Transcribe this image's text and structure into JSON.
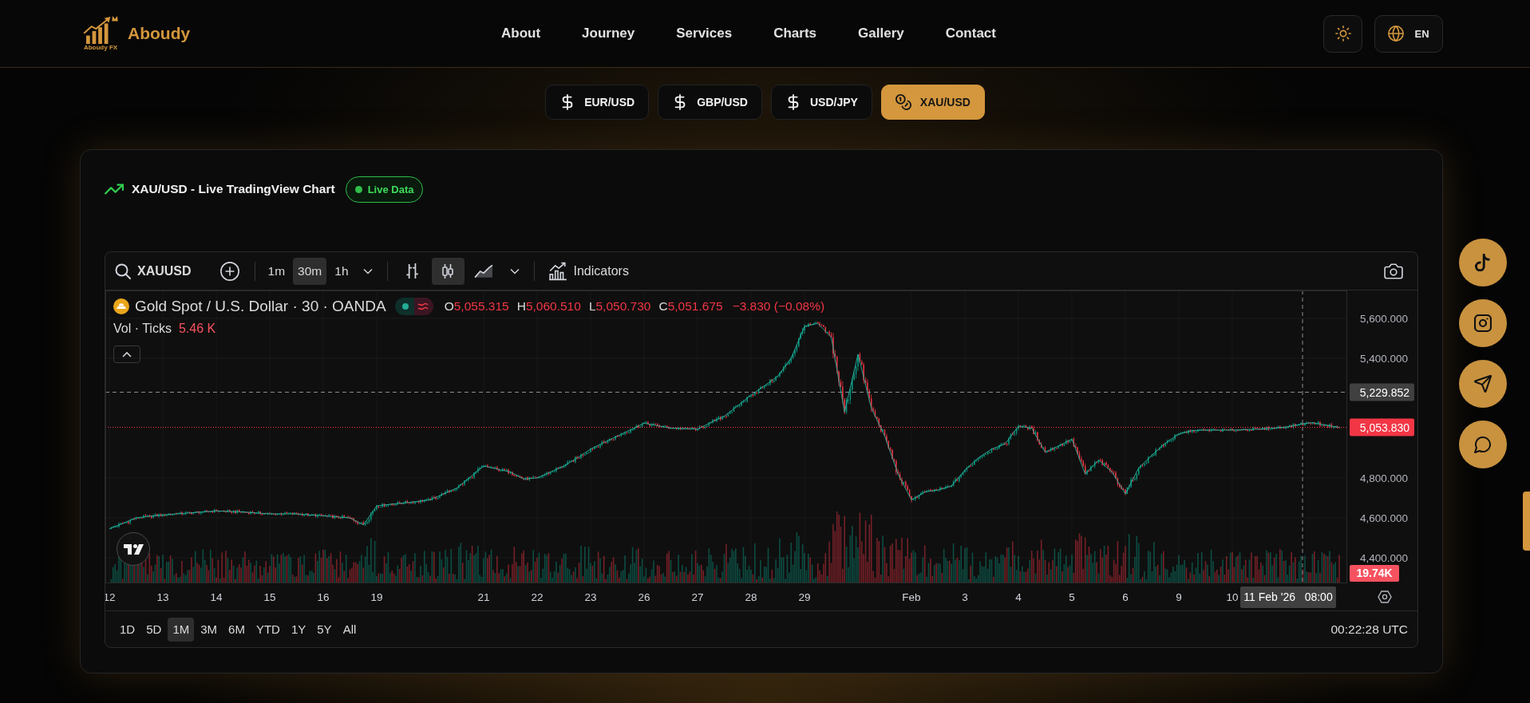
{
  "header": {
    "logo_caption": "Aboudy FX",
    "brand": "Aboudy",
    "nav": [
      "About",
      "Journey",
      "Services",
      "Charts",
      "Gallery",
      "Contact"
    ],
    "language": "EN"
  },
  "pairs": [
    {
      "label": "EUR/USD",
      "kind": "currency",
      "selected": false
    },
    {
      "label": "GBP/USD",
      "kind": "currency",
      "selected": false
    },
    {
      "label": "USD/JPY",
      "kind": "currency",
      "selected": false
    },
    {
      "label": "XAU/USD",
      "kind": "metal",
      "selected": true
    }
  ],
  "chart_card": {
    "title": "XAU/USD - Live TradingView Chart",
    "badge": "Live Data",
    "widget": {
      "symbol": "XAUUSD",
      "intervals": [
        {
          "label": "1m",
          "selected": false
        },
        {
          "label": "30m",
          "selected": true
        },
        {
          "label": "1h",
          "selected": false
        }
      ],
      "chart_types": [
        {
          "selected": false
        },
        {
          "selected": true
        },
        {
          "selected": false
        }
      ],
      "indicators": "Indicators",
      "legend": {
        "title": "Gold Spot / U.S. Dollar · 30 · OANDA",
        "ohlc": [
          {
            "key": "O",
            "value": "5,055.315"
          },
          {
            "key": "H",
            "value": "5,060.510"
          },
          {
            "key": "L",
            "value": "5,050.730"
          },
          {
            "key": "C",
            "value": "5,051.675"
          }
        ],
        "change": "−3.830 (−0.08%)"
      },
      "volume": {
        "label": "Vol · Ticks",
        "value": "5.46 K"
      },
      "volume_tag": "19.74K",
      "last_price": "5,053.830",
      "crosshair": {
        "price": "5,229.852",
        "time": "11 Feb '26   08:00"
      },
      "chart_data": {
        "type": "line",
        "categories": [
          "12",
          null,
          null,
          null,
          "13",
          null,
          null,
          null,
          "14",
          null,
          null,
          null,
          "15",
          null,
          null,
          null,
          "16",
          null,
          null,
          null,
          "19",
          null,
          null,
          null,
          null,
          null,
          null,
          null,
          "21",
          null,
          null,
          null,
          "22",
          null,
          null,
          null,
          "23",
          null,
          null,
          null,
          "26",
          null,
          null,
          null,
          "27",
          null,
          null,
          null,
          "28",
          null,
          null,
          null,
          "29",
          null,
          null,
          null,
          null,
          null,
          null,
          null,
          "Feb",
          null,
          null,
          null,
          "3",
          null,
          null,
          null,
          "4",
          null,
          null,
          null,
          "5",
          null,
          null,
          null,
          "6",
          null,
          null,
          null,
          "9",
          null,
          null,
          null,
          "10",
          null,
          null,
          null,
          null,
          null,
          null,
          null,
          null
        ],
        "values": [
          4545,
          4572,
          4600,
          4608,
          4615,
          4620,
          4625,
          4630,
          4635,
          4632,
          4630,
          4625,
          4620,
          4620,
          4620,
          4615,
          4610,
          4605,
          4600,
          4565,
          4660,
          4668,
          4675,
          4682,
          4690,
          4720,
          4750,
          4805,
          4860,
          4845,
          4830,
          4795,
          4800,
          4830,
          4860,
          4900,
          4945,
          4978,
          5010,
          5042,
          5075,
          5062,
          5050,
          5048,
          5045,
          5078,
          5110,
          5162,
          5215,
          5262,
          5310,
          5400,
          5560,
          5575,
          5505,
          5130,
          5420,
          5150,
          5010,
          4820,
          4690,
          4730,
          4740,
          4760,
          4840,
          4900,
          4945,
          4970,
          5060,
          5050,
          4930,
          4960,
          4995,
          4820,
          4890,
          4830,
          4720,
          4850,
          4915,
          4975,
          5020,
          5038,
          5040,
          5040,
          5040,
          5043,
          5045,
          5050,
          5055,
          5068,
          5078,
          5065,
          5054
        ],
        "ylim": [
          4272,
          5740
        ],
        "yticks": [
          {
            "value": 4400,
            "label": "4,400.000"
          },
          {
            "value": 4600,
            "label": "4,600.000"
          },
          {
            "value": 4800,
            "label": "4,800.000"
          },
          {
            "value": 5400,
            "label": "5,400.000"
          },
          {
            "value": 5600,
            "label": "5,600.000"
          }
        ]
      },
      "ranges": [
        {
          "label": "1D",
          "selected": false
        },
        {
          "label": "5D",
          "selected": false
        },
        {
          "label": "1M",
          "selected": true
        },
        {
          "label": "3M",
          "selected": false
        },
        {
          "label": "6M",
          "selected": false
        },
        {
          "label": "YTD",
          "selected": false
        },
        {
          "label": "1Y",
          "selected": false
        },
        {
          "label": "5Y",
          "selected": false
        },
        {
          "label": "All",
          "selected": false
        }
      ],
      "clock": "00:22:28 UTC"
    }
  }
}
